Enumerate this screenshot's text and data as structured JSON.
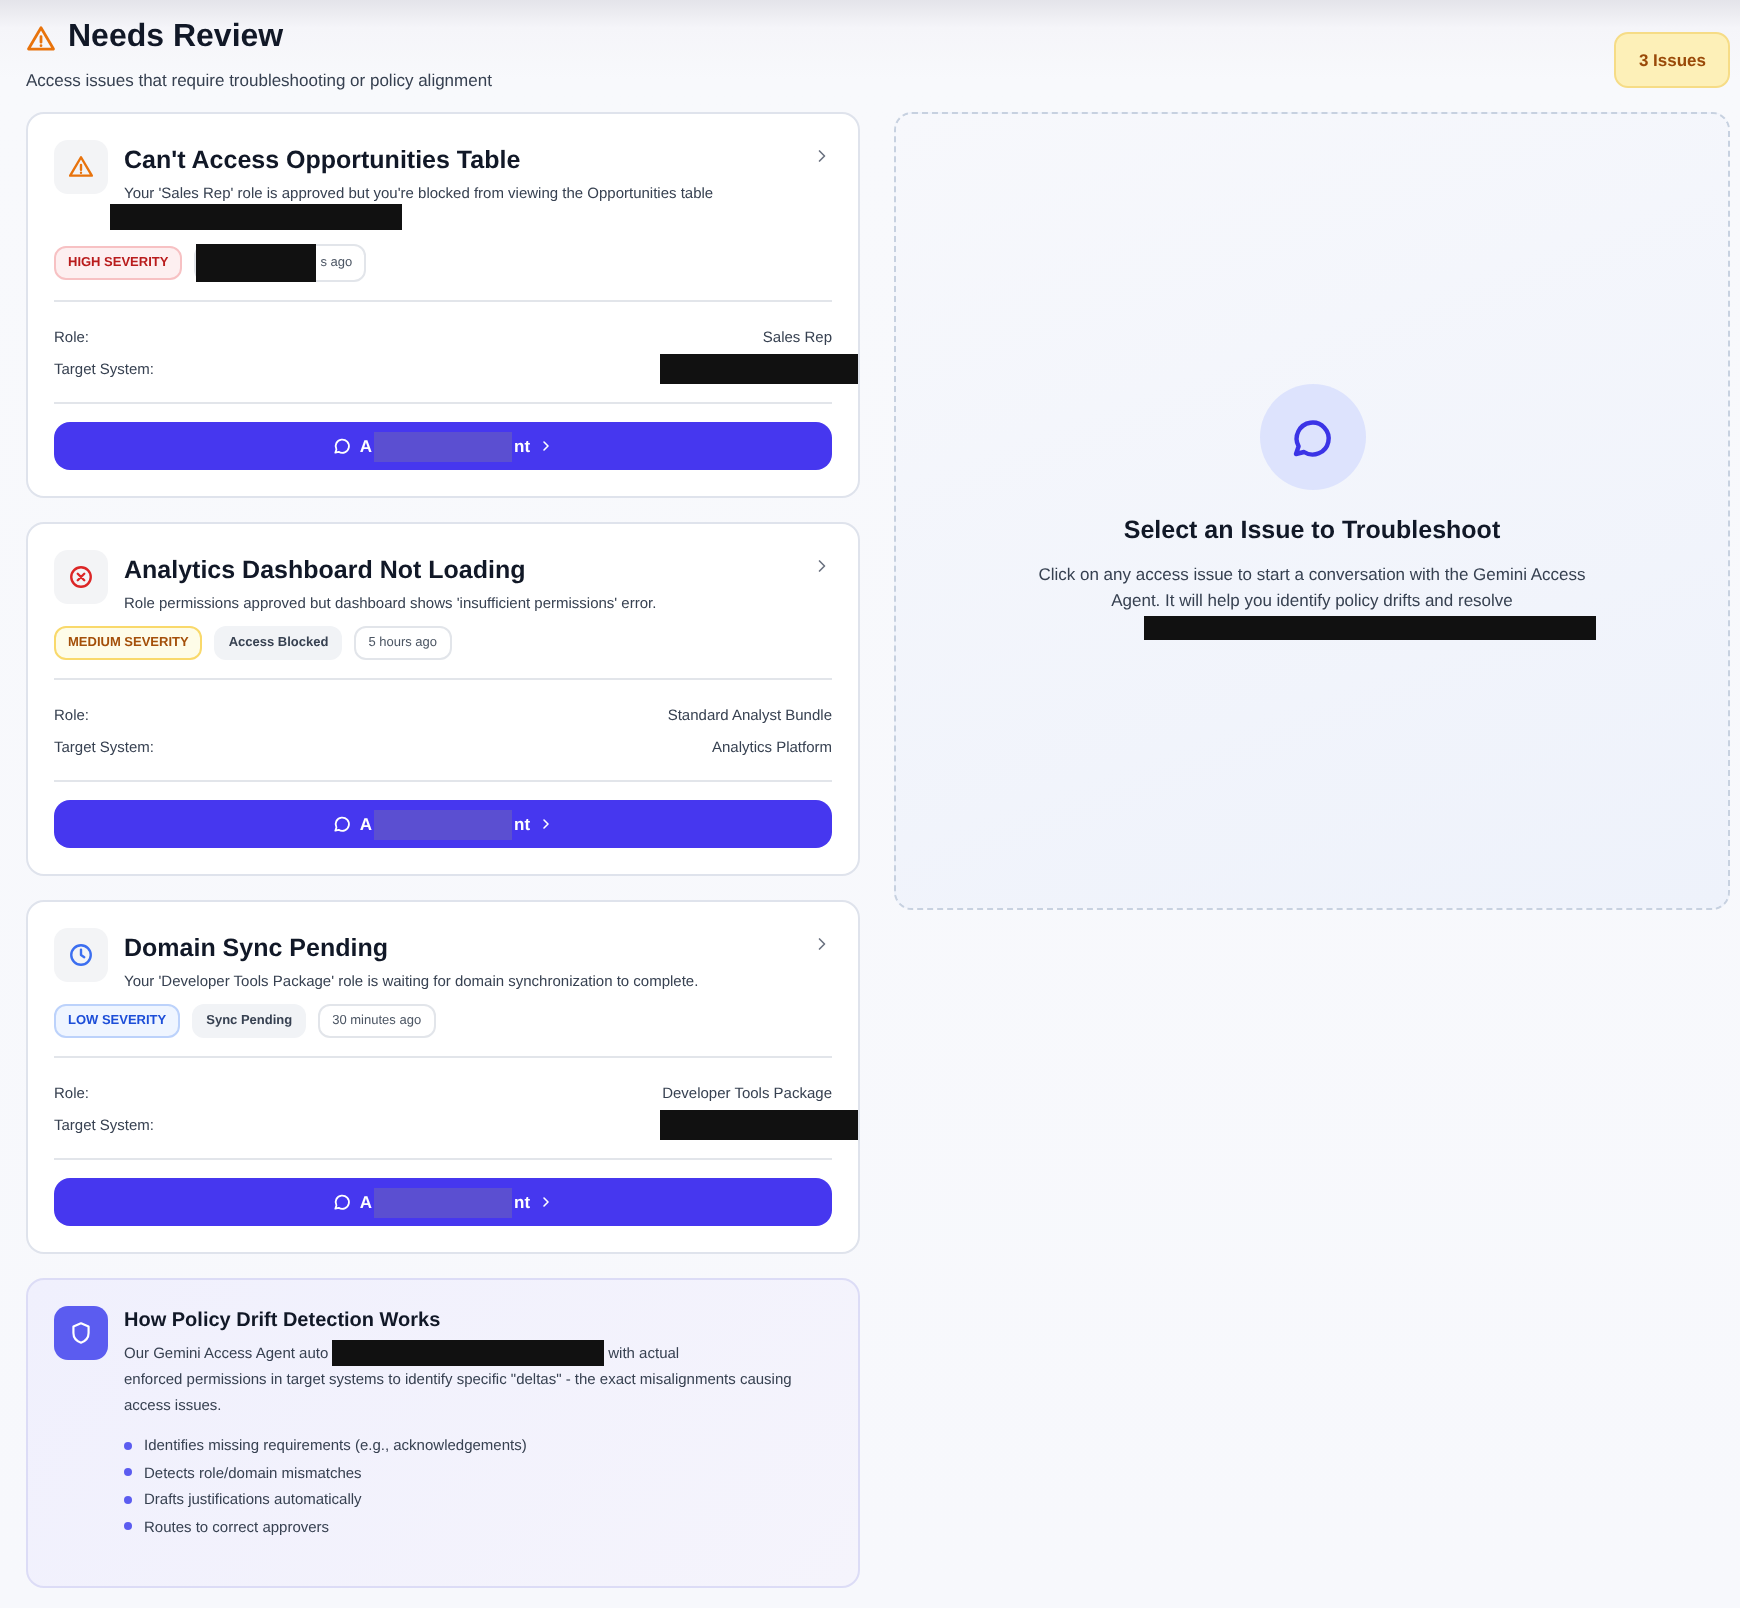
{
  "header": {
    "title": "Needs Review",
    "subtitle": "Access issues that require troubleshooting or policy alignment",
    "count_badge": "3 Issues"
  },
  "issues": [
    {
      "kind": "high",
      "title": "Can't Access Opportunities Table",
      "description": "Your 'Sales Rep' role is approved but you're blocked from viewing the Opportunities table",
      "description_redacted": true,
      "severity_label": "HIGH SEVERITY",
      "time": "s ago",
      "time_redacted": true,
      "details": [
        {
          "label": "Role:",
          "value": "Sales Rep"
        },
        {
          "label": "Target System:",
          "redacted": true
        }
      ],
      "button": {
        "start": "A",
        "end": "nt"
      }
    },
    {
      "kind": "medium",
      "title": "Analytics Dashboard Not Loading",
      "description": "Role permissions approved but dashboard shows 'insufficient permissions' error.",
      "severity_label": "MEDIUM SEVERITY",
      "tags": [
        "Access Blocked"
      ],
      "time": "5 hours ago",
      "details": [
        {
          "label": "Role:",
          "value": "Standard Analyst Bundle"
        },
        {
          "label": "Target System:",
          "value": "Analytics Platform"
        }
      ],
      "button": {
        "start": "A",
        "end": "nt"
      }
    },
    {
      "kind": "low",
      "title": "Domain Sync Pending",
      "description": "Your 'Developer Tools Package' role is waiting for domain synchronization to complete.",
      "severity_label": "LOW SEVERITY",
      "tags": [
        "Sync Pending"
      ],
      "time": "30 minutes ago",
      "details": [
        {
          "label": "Role:",
          "value": "Developer Tools Package"
        },
        {
          "label": "Target System:",
          "redacted": true
        }
      ],
      "button": {
        "start": "A",
        "end": "nt"
      }
    }
  ],
  "info": {
    "title": "How Policy Drift Detection Works",
    "text_before": "Our Gemini Access Agent auto",
    "text_redacted": true,
    "text_after": "with actual",
    "text_rest": "enforced permissions in target systems to identify specific \"deltas\" - the exact misalignments causing access issues.",
    "points": [
      "Identifies missing requirements (e.g., acknowledgements)",
      "Detects role/domain mismatches",
      "Drafts justifications automatically",
      "Routes to correct approvers"
    ]
  },
  "empty_state": {
    "title": "Select an Issue to Troubleshoot",
    "text": "Click on any access issue to start a conversation with the Gemini Access Agent. It will help you identify policy drifts and resolve",
    "text_redacted": true
  }
}
